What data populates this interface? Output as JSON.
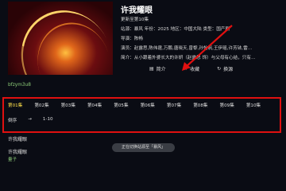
{
  "detail": {
    "title": "许我耀眼",
    "update": "更新至第10集",
    "info": "站源：暴风  年份：2025  地区：中国大陆  类型：国产剧",
    "director": "导演：陈畅",
    "cast": "演员：赵露思,陈伟霆,万鹏,唐晓天,曾黎,孙怡帆,王伊瑶,许芳铱,雷…",
    "plot": "简介：从小跟着外婆长大的许妍（赵露思 饰）与父母有心结，只有…"
  },
  "actions": {
    "intro": "简介",
    "favorite": "收藏",
    "change_source": "换源"
  },
  "user": "bfzym3u8",
  "episodes": [
    "第01集",
    "第02集",
    "第03集",
    "第04集",
    "第05集",
    "第06集",
    "第07集",
    "第08集",
    "第09集",
    "第10集"
  ],
  "range": {
    "sort_label": "倒序",
    "arrow": "→",
    "value": "1-10"
  },
  "below": {
    "line1": "许我耀眼",
    "line2": "许我耀眼",
    "line3": "量子"
  },
  "toast": "正在切换站源至「暴风」",
  "colors": {
    "highlight_box": "#e01010",
    "active_episode": "#ffe04a",
    "accent_green": "#8fcf7a"
  }
}
